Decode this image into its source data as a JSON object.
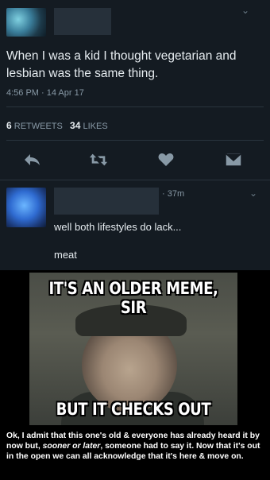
{
  "tweet": {
    "text": "When I was a kid I thought vegetarian and lesbian was the same thing.",
    "timestamp": "4:56 PM · 14 Apr 17",
    "retweets_count": "6",
    "retweets_label": "RETWEETS",
    "likes_count": "34",
    "likes_label": "LIKES"
  },
  "reply": {
    "time": "· 37m",
    "text1": "well both lifestyles do lack...",
    "text2": "meat"
  },
  "meme": {
    "top_text": "IT'S AN OLDER MEME, SIR",
    "bottom_text": "BUT IT CHECKS OUT"
  },
  "caption": {
    "part1": "Ok, I admit that this one's old & everyone has already heard it by now but, ",
    "emphasis": "sooner or later",
    "part2": ", someone had to say it. Now that it's out in the open we can all acknowledge that it's here & move on."
  },
  "icons": [
    "reply-icon",
    "retweet-icon",
    "like-icon",
    "message-icon",
    "chevron-down-icon"
  ]
}
